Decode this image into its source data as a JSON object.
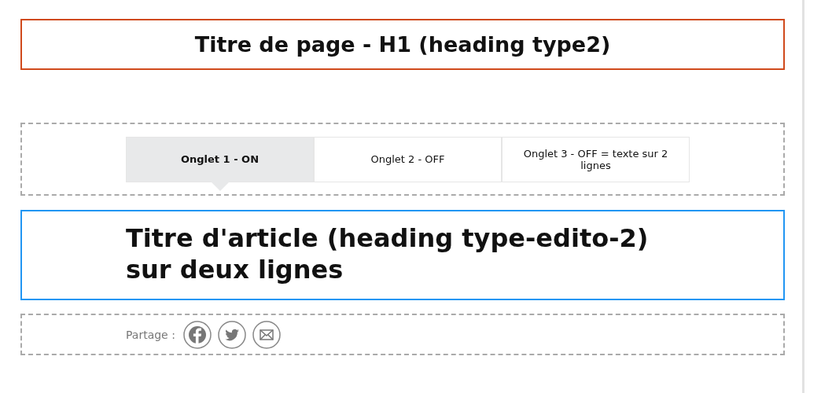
{
  "page_title": "Titre de page - H1 (heading type2)",
  "tabs": [
    {
      "label": "Onglet 1 - ON",
      "selected": true
    },
    {
      "label": "Onglet 2 - OFF",
      "selected": false
    },
    {
      "label": "Onglet 3 - OFF = texte sur 2 lignes",
      "selected": false
    }
  ],
  "article_title": "Titre d'article (heading type-edito-2) sur deux lignes",
  "share": {
    "label": "Partage :",
    "networks": [
      {
        "kind": "facebook"
      },
      {
        "kind": "twitter"
      },
      {
        "kind": "email"
      }
    ]
  }
}
